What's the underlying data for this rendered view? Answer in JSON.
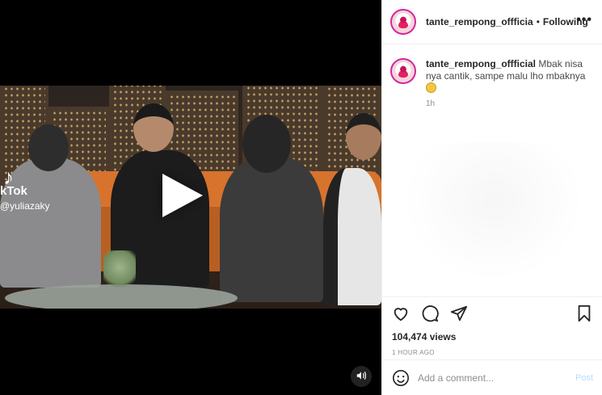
{
  "post": {
    "username": "tante_rempong_offficial",
    "header_username": "tante_rempong_offficia",
    "dot": "•",
    "follow_status": "Following",
    "more": "•••",
    "caption_user": "tante_rempong_offficial",
    "caption_text": "Mbak nisa nya cantik, sampe malu lho mbaknya",
    "caption_emoji": "grimacing-face-emoji",
    "caption_time": "1h",
    "views": "104,474 views",
    "time_ago": "1 HOUR AGO"
  },
  "video": {
    "watermark_brand": "kTok",
    "watermark_user": "@yuliazaky",
    "sound_icon": "speaker-icon"
  },
  "comment_box": {
    "placeholder": "Add a comment...",
    "post_label": "Post"
  },
  "colors": {
    "accent_disabled": "#b2dffc",
    "avatar_ring": "#d6249f",
    "text": "#262626",
    "muted": "#8e8e8e"
  },
  "icons": [
    "heart-icon",
    "comment-icon",
    "share-icon",
    "bookmark-icon",
    "emoji-icon",
    "play-icon",
    "tiktok-icon"
  ]
}
